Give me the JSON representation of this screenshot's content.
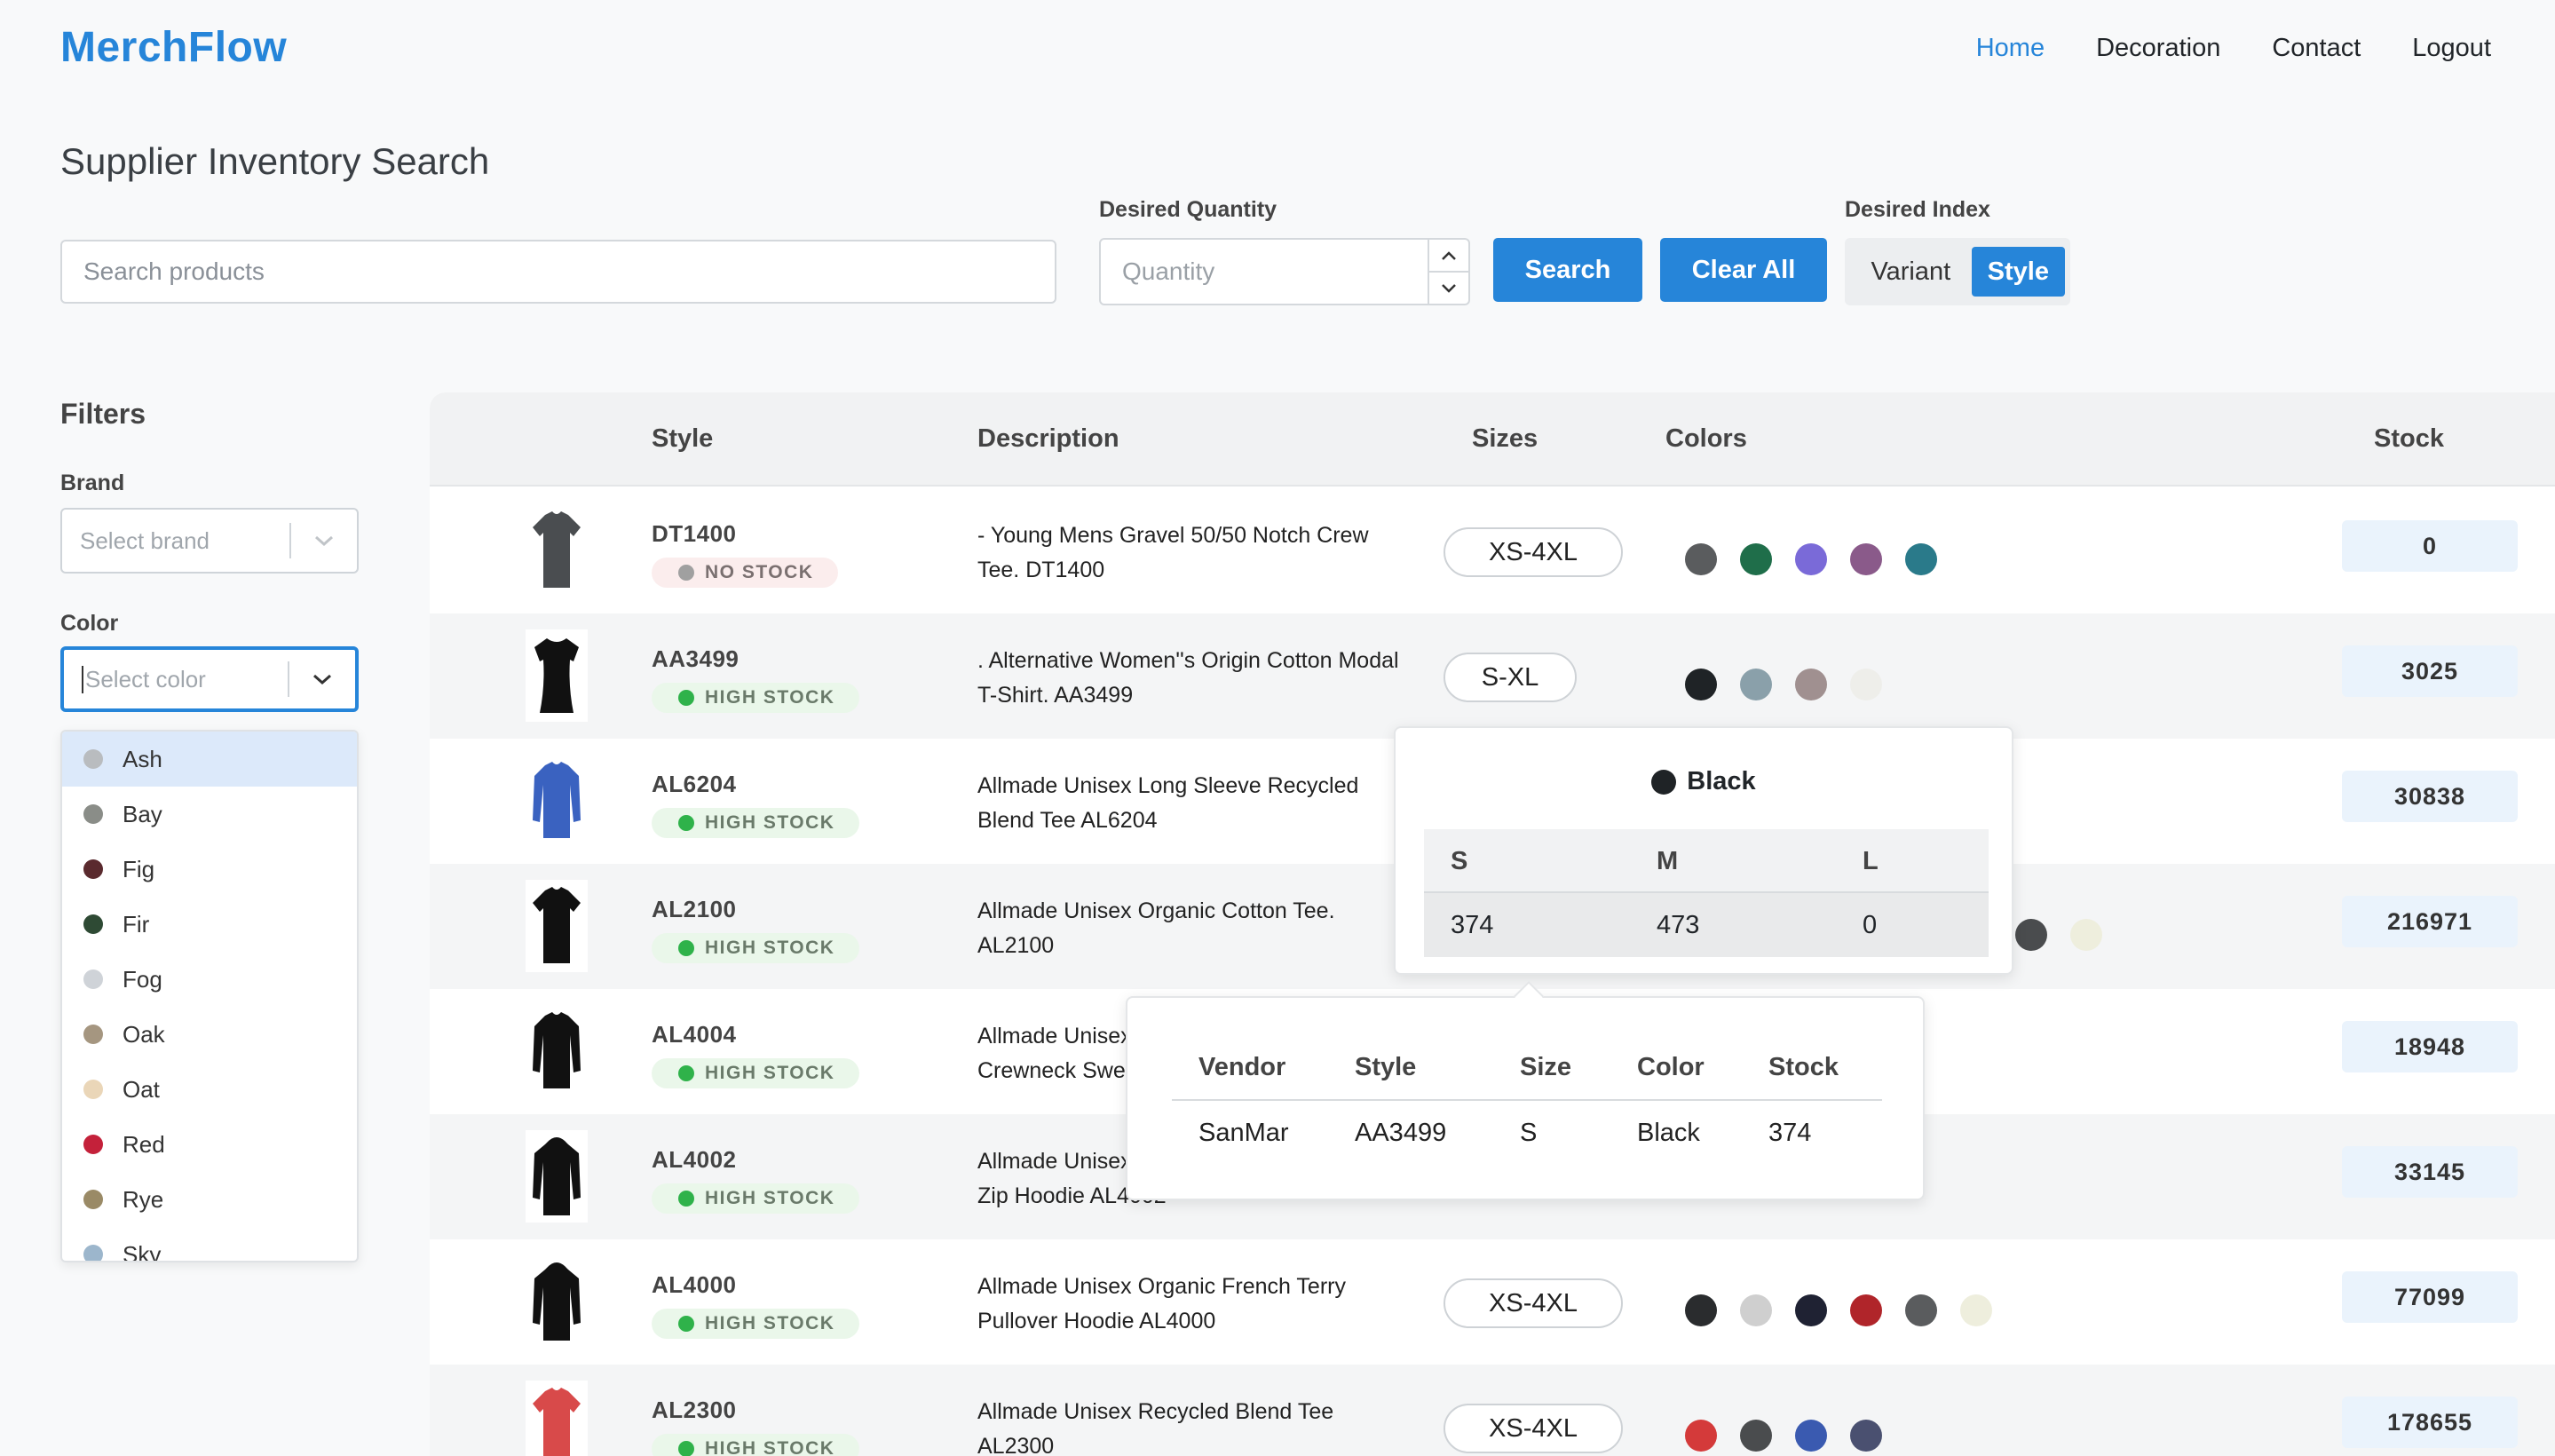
{
  "header": {
    "logo": "MerchFlow",
    "nav": [
      "Home",
      "Decoration",
      "Contact",
      "Logout"
    ],
    "active_nav": "Home"
  },
  "page_title": "Supplier Inventory Search",
  "search": {
    "placeholder": "Search products",
    "quantity_label": "Desired Quantity",
    "quantity_placeholder": "Quantity",
    "search_button": "Search",
    "clear_button": "Clear All",
    "index_label": "Desired Index",
    "index_options": [
      "Variant",
      "Style"
    ],
    "index_selected": "Style"
  },
  "filters": {
    "title": "Filters",
    "brand_label": "Brand",
    "brand_placeholder": "Select brand",
    "color_label": "Color",
    "color_placeholder": "Select color",
    "color_options": [
      {
        "name": "Ash",
        "color": "#b9bcbf"
      },
      {
        "name": "Bay",
        "color": "#8a8d88"
      },
      {
        "name": "Fig",
        "color": "#5a2a2e"
      },
      {
        "name": "Fir",
        "color": "#2e4a34"
      },
      {
        "name": "Fog",
        "color": "#cfd3d8"
      },
      {
        "name": "Oak",
        "color": "#a59680"
      },
      {
        "name": "Oat",
        "color": "#ead6b8"
      },
      {
        "name": "Red",
        "color": "#c4213a"
      },
      {
        "name": "Rye",
        "color": "#9a8a66"
      },
      {
        "name": "Sky",
        "color": "#9cb6cc"
      }
    ]
  },
  "table": {
    "headers": [
      "Style",
      "Description",
      "Sizes",
      "Colors",
      "Stock"
    ],
    "rows": [
      {
        "style": "DT1400",
        "badge": "NO STOCK",
        "description": "- Young Mens Gravel 50/50 Notch Crew Tee. DT1400",
        "sizes": "XS-4XL",
        "colors": [
          "#5a5c5e",
          "#1f6e4a",
          "#7a6ad8",
          "#8a5a8a",
          "#2a7a8a"
        ],
        "stock": "0",
        "thumb_color": "#4a4d50",
        "thumb": "tee-icon"
      },
      {
        "style": "AA3499",
        "badge": "HIGH STOCK",
        "description": ". Alternative Women''s Origin Cotton Modal T-Shirt. AA3499",
        "sizes": "S-XL",
        "colors": [
          "#1f2326",
          "#8aa0aa",
          "#a09090",
          "#eeeeea"
        ],
        "stock": "3025",
        "thumb_color": "#111111",
        "thumb": "womens-tee-icon"
      },
      {
        "style": "AL6204",
        "badge": "HIGH STOCK",
        "description": "Allmade Unisex Long Sleeve Recycled Blend Tee AL6204",
        "sizes": "",
        "colors": [],
        "stock": "30838",
        "thumb_color": "#3a62c0",
        "thumb": "long-sleeve-icon"
      },
      {
        "style": "AL2100",
        "badge": "HIGH STOCK",
        "description": "Allmade Unisex Organic Cotton Tee. AL2100",
        "sizes": "",
        "colors": [
          "#4a4c4e",
          "#eeeedd"
        ],
        "stock": "216971",
        "thumb_color": "#111111",
        "thumb": "tee-icon"
      },
      {
        "style": "AL4004",
        "badge": "HIGH STOCK",
        "description": "Allmade Unisex Organic French Terry Crewneck Sweatshirt AL4004",
        "sizes": "",
        "colors": [],
        "stock": "18948",
        "thumb_color": "#111111",
        "thumb": "sweatshirt-icon"
      },
      {
        "style": "AL4002",
        "badge": "HIGH STOCK",
        "description": "Allmade Unisex Organic French Terry Full-Zip Hoodie AL4002",
        "sizes": "",
        "colors": [],
        "stock": "33145",
        "thumb_color": "#111111",
        "thumb": "hoodie-icon"
      },
      {
        "style": "AL4000",
        "badge": "HIGH STOCK",
        "description": "Allmade Unisex Organic French Terry Pullover Hoodie AL4000",
        "sizes": "XS-4XL",
        "colors": [
          "#2a2c2e",
          "#cfcfcf",
          "#1f2233",
          "#b0252a",
          "#5a5c5e",
          "#eeeedd"
        ],
        "stock": "77099",
        "thumb_color": "#111111",
        "thumb": "hoodie-icon"
      },
      {
        "style": "AL2300",
        "badge": "HIGH STOCK",
        "description": "Allmade Unisex Recycled Blend Tee AL2300",
        "sizes": "XS-4XL",
        "colors": [
          "#d43a3a",
          "#4a4c4e",
          "#3a5ab0",
          "#4a5070"
        ],
        "stock": "178655",
        "thumb_color": "#d84a4a",
        "thumb": "tee-icon"
      }
    ]
  },
  "color_popover": {
    "color_name": "Black",
    "color": "#1f2326",
    "sizes": [
      "S",
      "M",
      "L"
    ],
    "values": [
      "374",
      "473",
      "0"
    ]
  },
  "vendor_popover": {
    "headers": [
      "Vendor",
      "Style",
      "Size",
      "Color",
      "Stock"
    ],
    "values": [
      "SanMar",
      "AA3499",
      "S",
      "Black",
      "374"
    ]
  }
}
